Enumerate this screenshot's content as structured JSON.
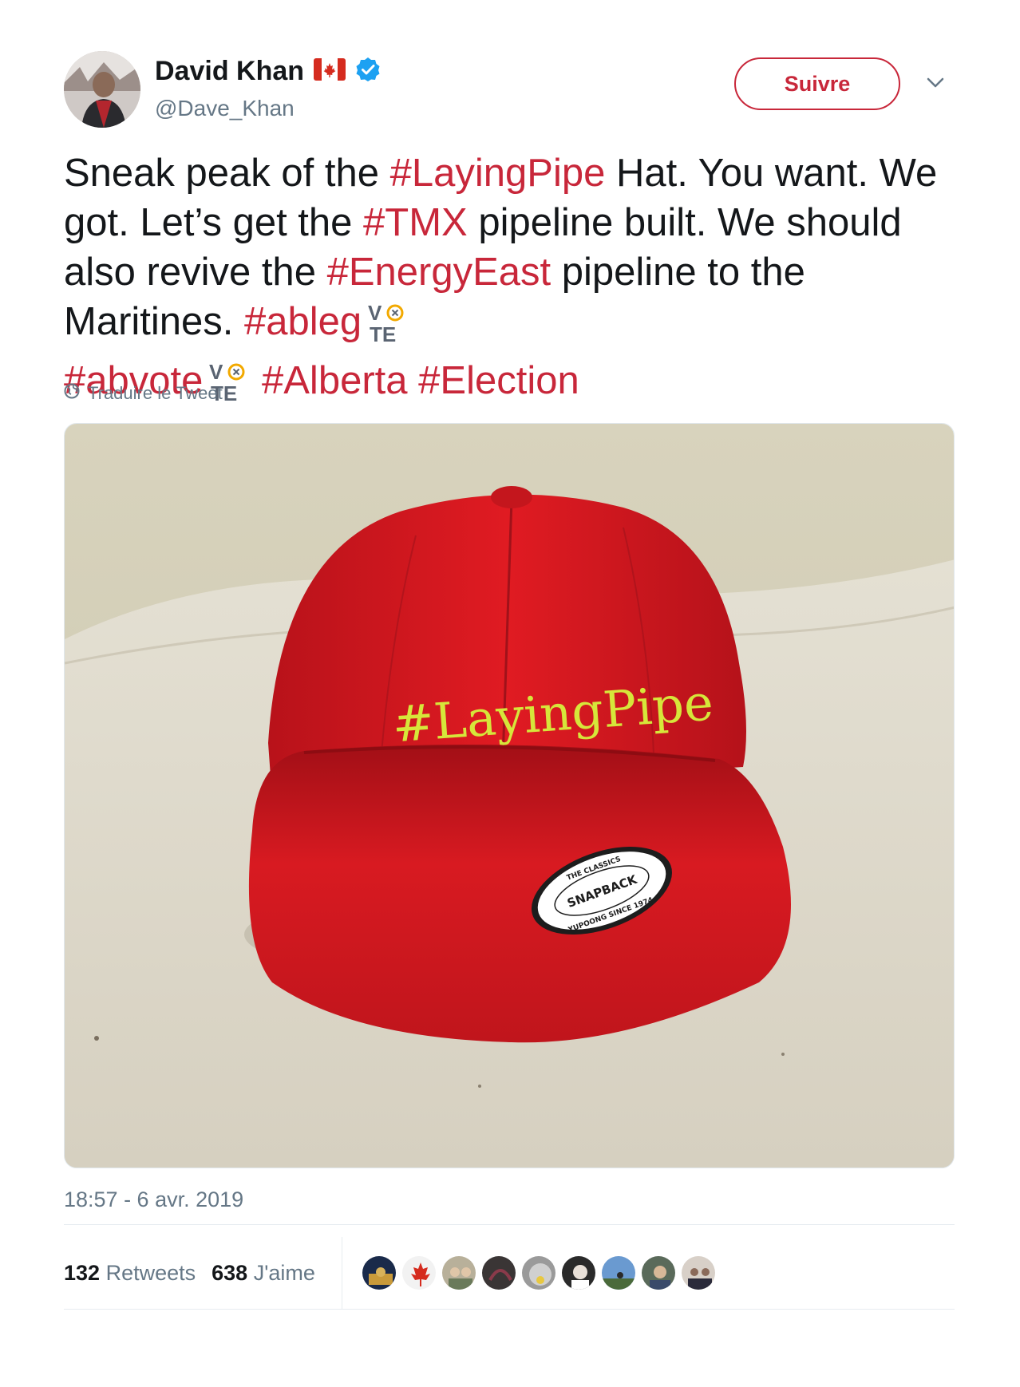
{
  "author": {
    "display_name": "David Khan",
    "handle": "@Dave_Khan",
    "flag": "canada-flag-icon",
    "verified": true
  },
  "follow_button": {
    "label": "Suivre"
  },
  "tweet": {
    "text_parts": {
      "p1": "Sneak peak of the ",
      "h1": "#LayingPipe",
      "p2": " Hat. You want. We got. Let’s get the ",
      "h2": "#TMX",
      "p3": " pipeline built. We should also revive the ",
      "h3": "#EnergyEast",
      "p4": " pipeline to the Maritines. ",
      "h4": "#ableg",
      "h5": "#abvote",
      "h6": "#Alberta",
      "h7": "#Election"
    },
    "translate_label": "Traduire le Tweet"
  },
  "photo": {
    "hat_text": "#LayingPipe",
    "label_top": "THE CLASSICS",
    "label_middle": "SNAPBACK",
    "label_bottom": "YUPOONG SINCE 1974"
  },
  "timestamp": "18:57 - 6 avr. 2019",
  "stats": {
    "retweets_count": "132",
    "retweets_label": "Retweets",
    "likes_count": "638",
    "likes_label": "J'aime"
  },
  "colors": {
    "accent": "#c8273a",
    "text": "#14171a",
    "muted": "#657786",
    "verified": "#1da1f2"
  }
}
